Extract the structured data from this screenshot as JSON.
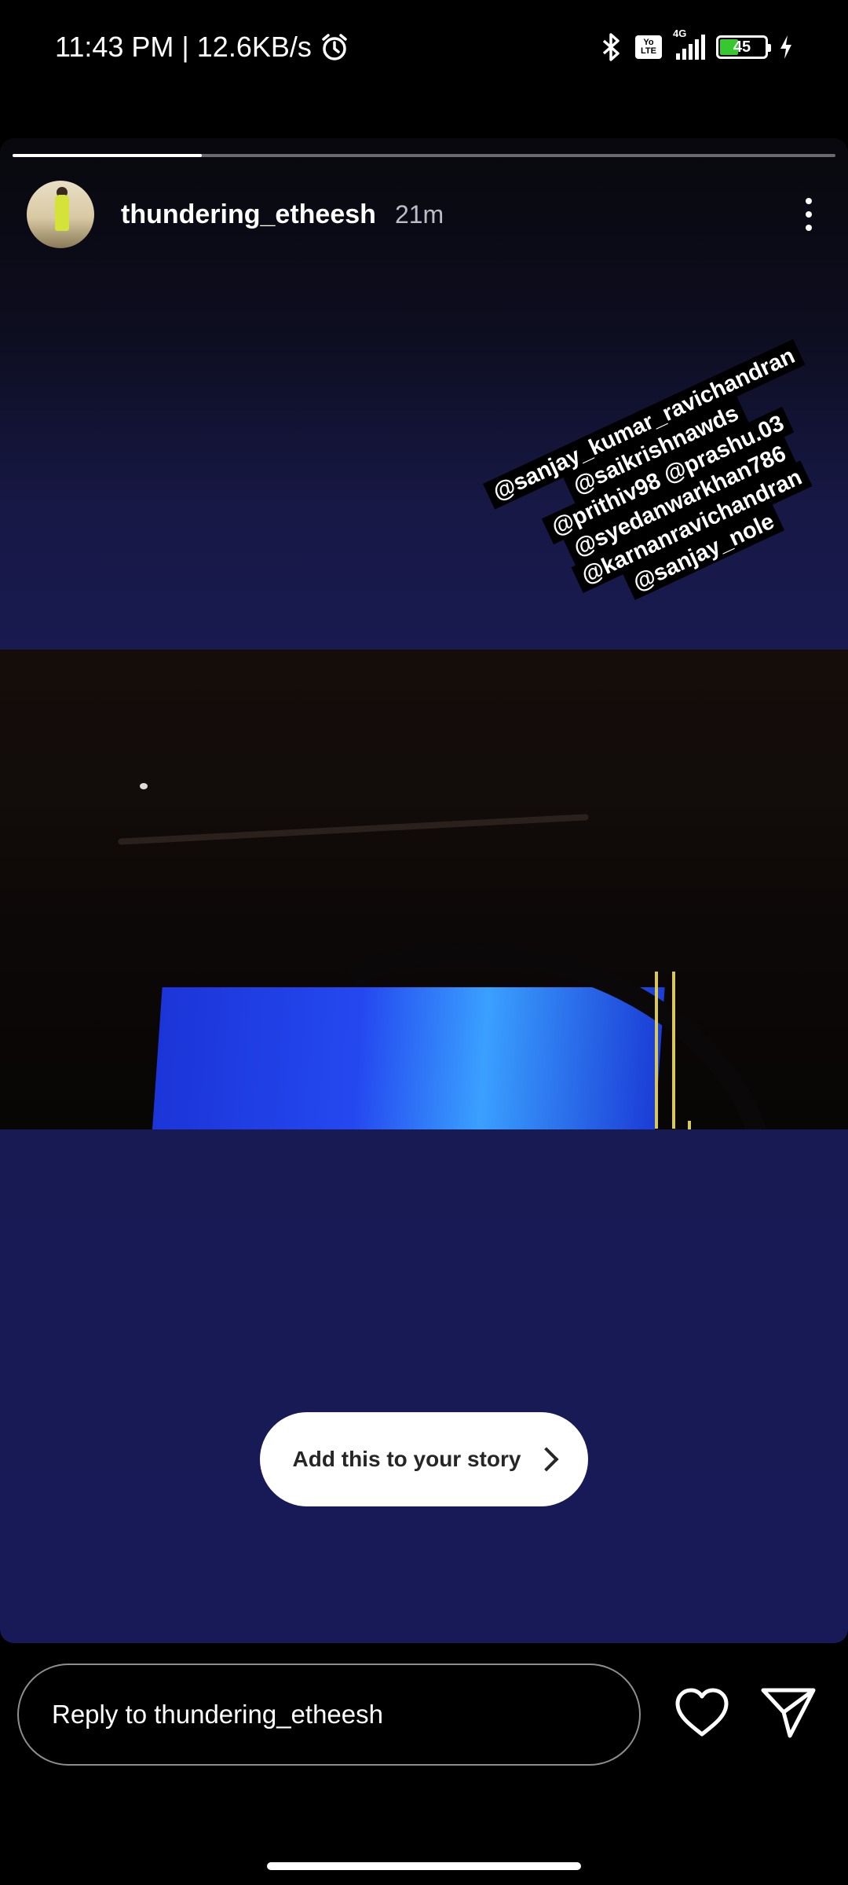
{
  "status_bar": {
    "time": "11:43 PM",
    "separator": "|",
    "net_speed": "12.6KB/s",
    "volte_top": "Yo",
    "volte_bottom": "LTE",
    "network": "4G",
    "battery_level": "45",
    "battery_fraction": 0.45,
    "battery_color": "#37c72f"
  },
  "story": {
    "progress_fraction": 0.23,
    "username": "thundering_etheesh",
    "timestamp": "21m",
    "mentions": [
      "@sanjay_kumar_ravichandran",
      "@saikrishnawds",
      "@prithiv98 @prashu.03",
      "@syedanwarkhan786",
      "@karnanravichandran",
      "@sanjay_nole"
    ],
    "add_to_story_label": "Add this to your story"
  },
  "reply_bar": {
    "placeholder": "Reply to thundering_etheesh"
  },
  "icons": {
    "alarm": "alarm-icon",
    "bluetooth": "bluetooth-icon",
    "more": "more-vertical-icon",
    "heart": "heart-icon",
    "send": "send-icon",
    "chevron": "chevron-right-icon"
  }
}
